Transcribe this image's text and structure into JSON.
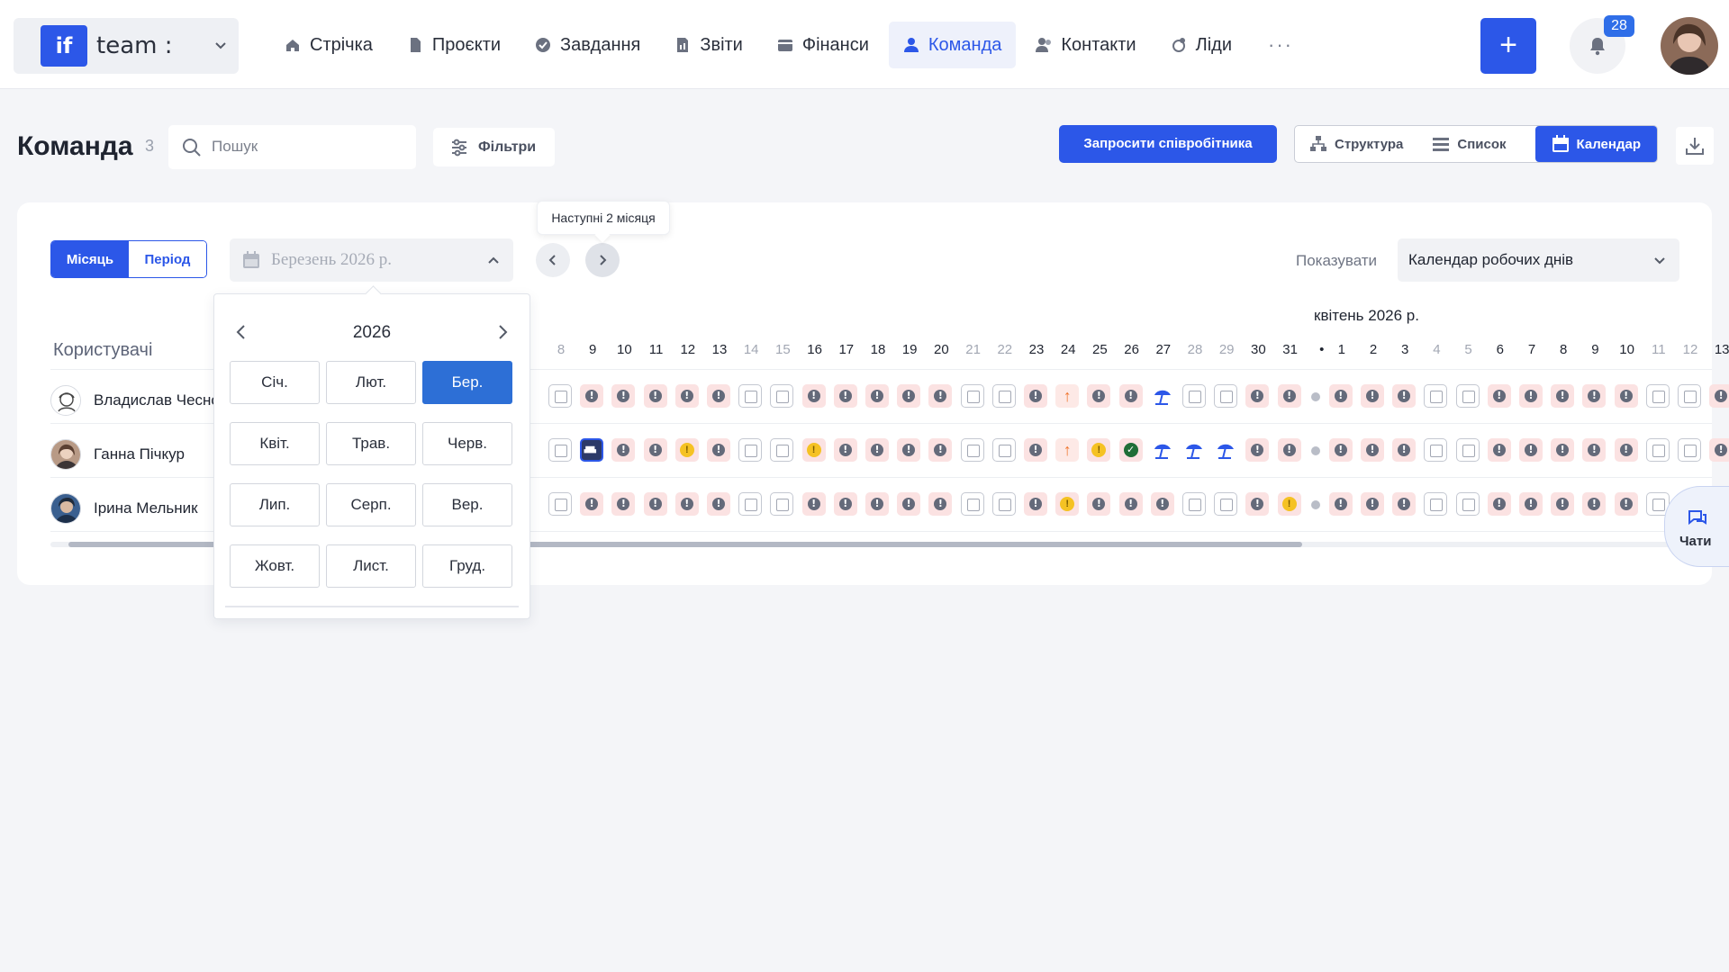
{
  "brand": {
    "logo": "if",
    "name": "team :"
  },
  "nav": [
    {
      "label": "Стрічка",
      "icon": "home-icon"
    },
    {
      "label": "Проєкти",
      "icon": "file-icon"
    },
    {
      "label": "Завдання",
      "icon": "check-circle-icon"
    },
    {
      "label": "Звіти",
      "icon": "report-icon"
    },
    {
      "label": "Фінанси",
      "icon": "wallet-icon"
    },
    {
      "label": "Команда",
      "icon": "user-icon",
      "active": true
    },
    {
      "label": "Контакти",
      "icon": "contacts-icon"
    },
    {
      "label": "Ліди",
      "icon": "leads-icon"
    }
  ],
  "nav_more": "···",
  "notifications": {
    "count": "28"
  },
  "page": {
    "title": "Команда",
    "count": "3"
  },
  "search": {
    "placeholder": "Пошук"
  },
  "filters": {
    "label": "Фільтри"
  },
  "invite": {
    "label": "Запросити співробітника"
  },
  "views": [
    {
      "label": "Структура",
      "icon": "org-chart-icon"
    },
    {
      "label": "Список",
      "icon": "list-icon"
    },
    {
      "label": "Календар",
      "icon": "calendar-icon",
      "active": true
    }
  ],
  "calendar": {
    "mode": [
      {
        "label": "Місяць",
        "active": true
      },
      {
        "label": "Період"
      }
    ],
    "selected_month": "Березень 2026 р.",
    "tooltip": "Наступні 2 місяця",
    "show_label": "Показувати",
    "show_value": "Календар робочих днів",
    "users_header": "Користувачі",
    "next_month_label": "квітень 2026 р.",
    "days": [
      {
        "d": "8",
        "w": true
      },
      {
        "d": "9"
      },
      {
        "d": "10"
      },
      {
        "d": "11"
      },
      {
        "d": "12"
      },
      {
        "d": "13"
      },
      {
        "d": "14",
        "w": true
      },
      {
        "d": "15",
        "w": true
      },
      {
        "d": "16"
      },
      {
        "d": "17"
      },
      {
        "d": "18"
      },
      {
        "d": "19"
      },
      {
        "d": "20"
      },
      {
        "d": "21",
        "w": true
      },
      {
        "d": "22",
        "w": true
      },
      {
        "d": "23"
      },
      {
        "d": "24"
      },
      {
        "d": "25"
      },
      {
        "d": "26"
      },
      {
        "d": "27"
      },
      {
        "d": "28",
        "w": true
      },
      {
        "d": "29",
        "w": true
      },
      {
        "d": "30"
      },
      {
        "d": "31"
      },
      {
        "d": "•",
        "sep": true
      },
      {
        "d": "1"
      },
      {
        "d": "2"
      },
      {
        "d": "3"
      },
      {
        "d": "4",
        "w": true
      },
      {
        "d": "5",
        "w": true
      },
      {
        "d": "6"
      },
      {
        "d": "7"
      },
      {
        "d": "8"
      },
      {
        "d": "9"
      },
      {
        "d": "10"
      },
      {
        "d": "11",
        "w": true
      },
      {
        "d": "12",
        "w": true
      },
      {
        "d": "13"
      }
    ],
    "users": [
      {
        "name": "Владислав Чеснок",
        "avatar": "avatar-icon-illustration",
        "cells": [
          "o",
          "w",
          "w",
          "w",
          "w",
          "w",
          "o",
          "o",
          "w",
          "w",
          "w",
          "w",
          "w",
          "o",
          "o",
          "w",
          "up",
          "w",
          "w",
          "v",
          "o",
          "o",
          "w",
          "w",
          "dot",
          "w",
          "w",
          "w",
          "o",
          "o",
          "w",
          "w",
          "w",
          "w",
          "w",
          "o",
          "o",
          "w"
        ]
      },
      {
        "name": "Ганна Пічкур",
        "avatar": "avatar-photo",
        "cells": [
          "o",
          "s",
          "w",
          "w",
          "y",
          "w",
          "o",
          "o",
          "y",
          "w",
          "w",
          "w",
          "w",
          "o",
          "o",
          "w",
          "up",
          "y",
          "ok",
          "v",
          "v",
          "v",
          "w",
          "w",
          "dot",
          "w",
          "w",
          "w",
          "o",
          "o",
          "w",
          "w",
          "w",
          "w",
          "w",
          "o",
          "o",
          "w"
        ]
      },
      {
        "name": "Ірина Мельник",
        "avatar": "avatar-photo",
        "cells": [
          "o",
          "w",
          "w",
          "w",
          "w",
          "w",
          "o",
          "o",
          "w",
          "w",
          "w",
          "w",
          "w",
          "o",
          "o",
          "w",
          "y",
          "w",
          "w",
          "w",
          "o",
          "o",
          "w",
          "y",
          "dot",
          "w",
          "w",
          "w",
          "o",
          "o",
          "w",
          "w",
          "w",
          "w",
          "w",
          "o",
          "o",
          "w"
        ]
      }
    ]
  },
  "month_dropdown": {
    "year": "2026",
    "months": [
      "Січ.",
      "Лют.",
      "Бер.",
      "Квіт.",
      "Трав.",
      "Черв.",
      "Лип.",
      "Серп.",
      "Вер.",
      "Жовт.",
      "Лист.",
      "Груд."
    ],
    "active_index": 2
  },
  "chats": {
    "label": "Чати"
  },
  "colors": {
    "accent": "#2c57e8",
    "workday": "#fbe2e2",
    "vacation": "#2c57e8",
    "late": "#f5c223",
    "approved": "#1f6e37"
  }
}
